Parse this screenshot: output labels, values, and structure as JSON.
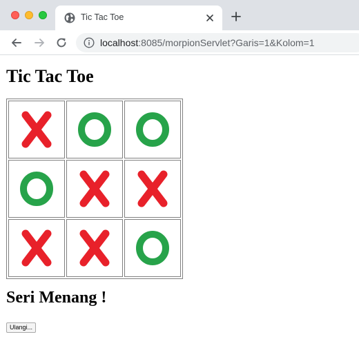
{
  "browser": {
    "tab_title": "Tic Tac Toe",
    "url_host": "localhost",
    "url_rest": ":8085/morpionServlet?Garis=1&Kolom=1"
  },
  "page": {
    "heading": "Tic Tac Toe",
    "result_text": "Seri Menang !",
    "reset_button_label": "Ulangi..."
  },
  "board": [
    [
      "X",
      "O",
      "O"
    ],
    [
      "O",
      "X",
      "X"
    ],
    [
      "X",
      "X",
      "O"
    ]
  ],
  "colors": {
    "x_mark": "#e8212a",
    "o_mark": "#27a34a"
  }
}
